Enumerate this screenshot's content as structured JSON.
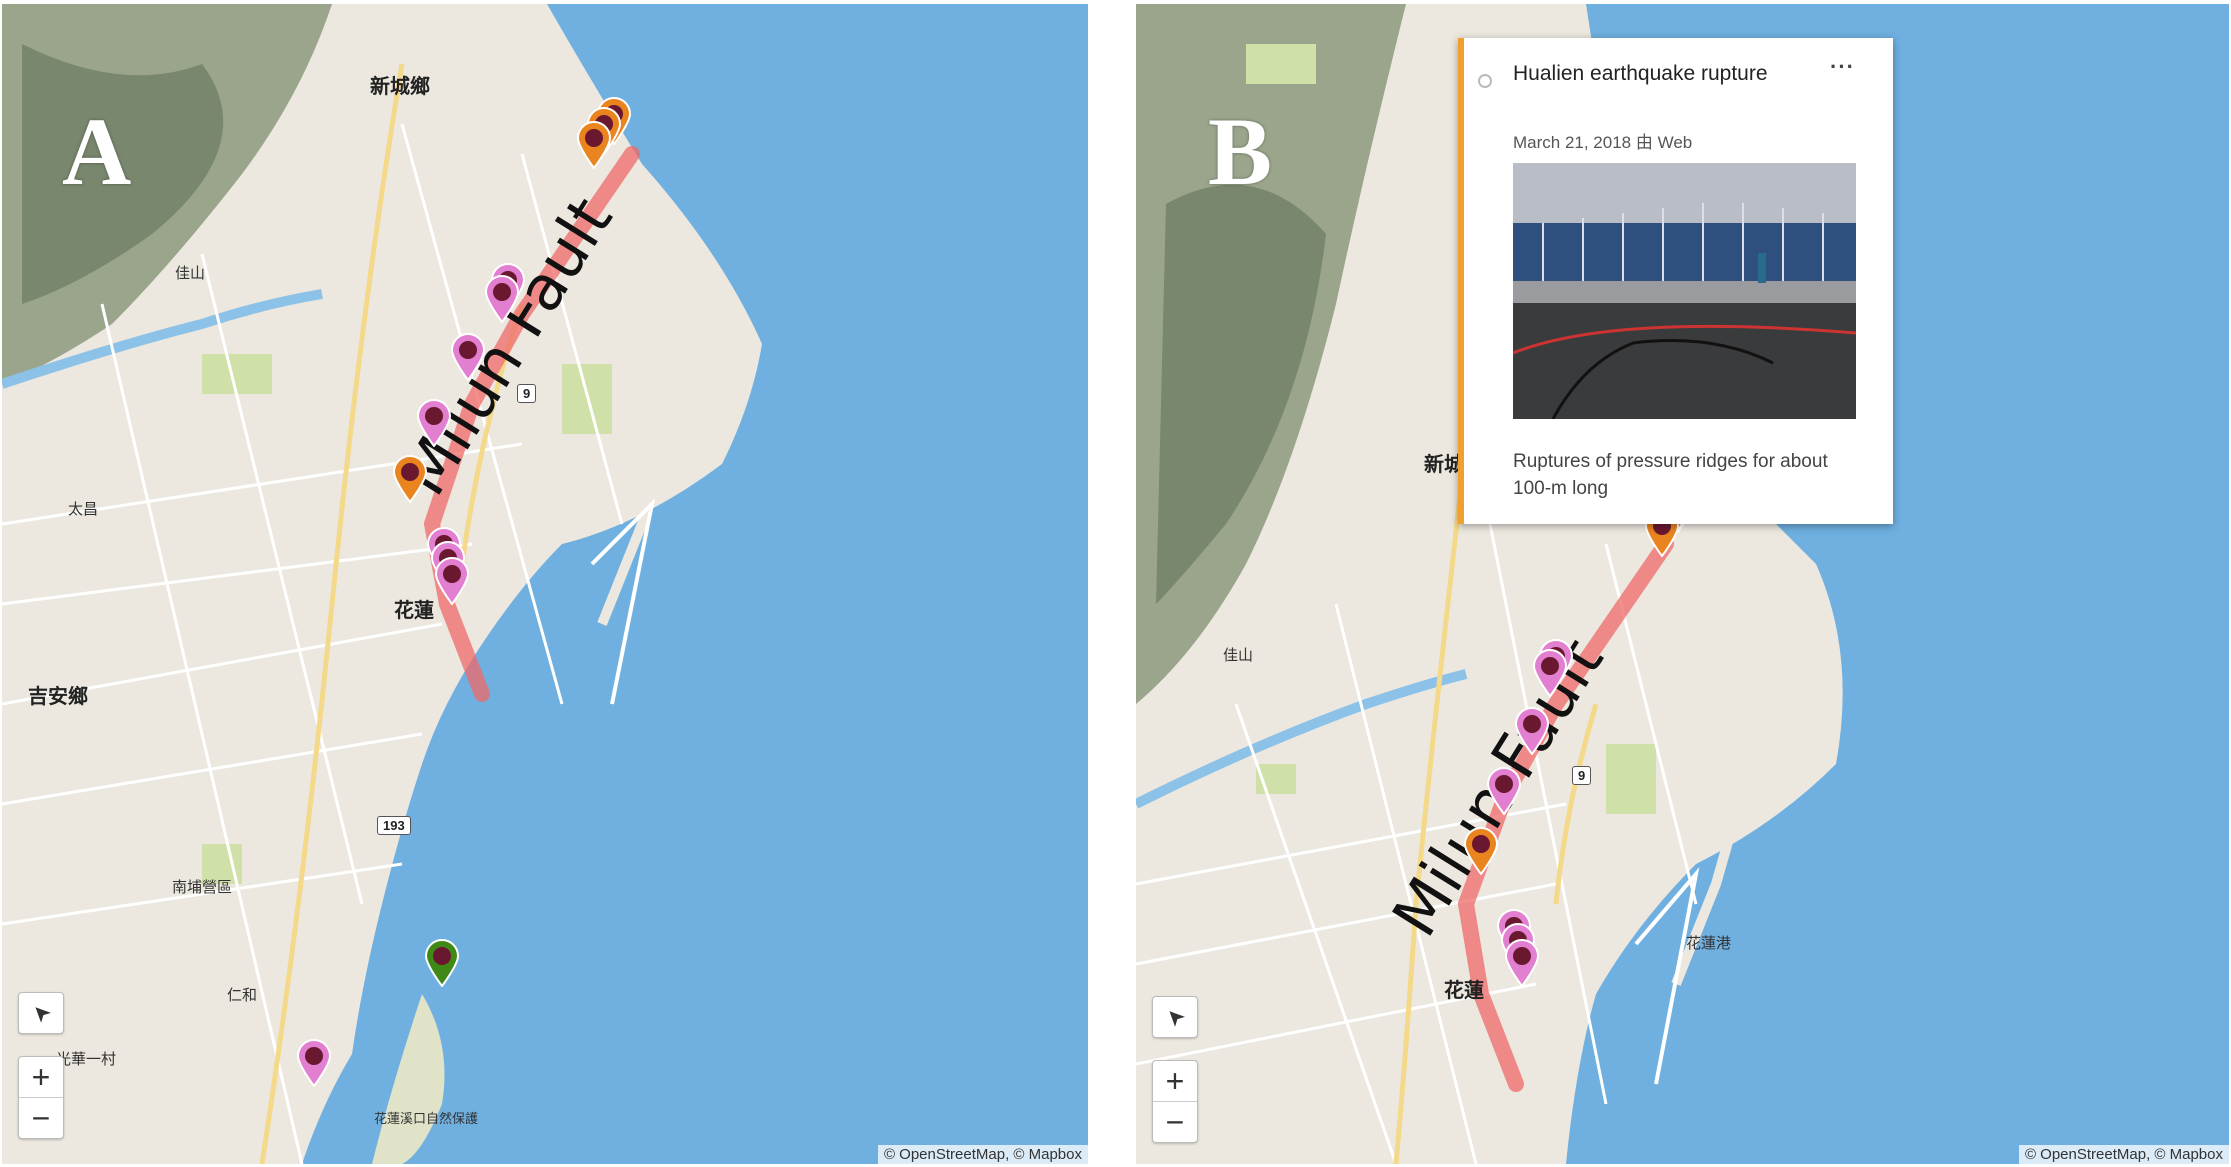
{
  "panel_a": {
    "letter": "A",
    "fault_label": "Milun Fault",
    "places": [
      "新城鄉",
      "花蓮",
      "吉安鄉",
      "佳山",
      "太昌",
      "南埔營區",
      "光華一村",
      "仁和",
      "花蓮溪口自然保護"
    ],
    "road_shields": [
      "9",
      "193"
    ],
    "attribution": "© OpenStreetMap, © Mapbox",
    "controls": {
      "locate": "➤",
      "zoom_in": "+",
      "zoom_out": "−"
    }
  },
  "panel_b": {
    "letter": "B",
    "fault_label": "Milun Fault",
    "places": [
      "花蓮",
      "佳山",
      "新城",
      "花蓮港"
    ],
    "road_shields": [
      "9"
    ],
    "attribution": "© OpenStreetMap, © Mapbox",
    "controls": {
      "locate": "➤",
      "zoom_in": "+",
      "zoom_out": "−"
    },
    "popup": {
      "title": "Hualien earthquake rupture",
      "more": "···",
      "meta": "March 21, 2018 由 Web",
      "description": "Ruptures of pressure ridges for about 100-m long"
    }
  },
  "colors": {
    "sea": "#6fb0e0",
    "land": "#ece8df",
    "fault_line": "#ef6a6a",
    "pin_pink": "#e27fd0",
    "pin_orange": "#e9841f",
    "pin_green": "#3f8a16",
    "popup_accent": "#f0a030"
  }
}
